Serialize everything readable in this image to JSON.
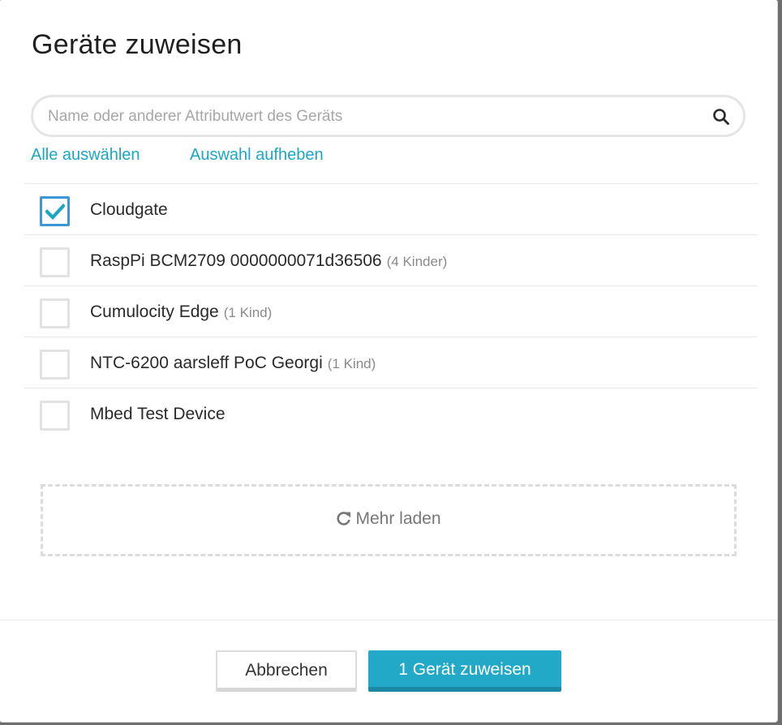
{
  "dialog": {
    "title": "Geräte zuweisen"
  },
  "search": {
    "placeholder": "Name oder anderer Attributwert des Geräts",
    "value": ""
  },
  "actions": {
    "select_all": "Alle auswählen",
    "clear_selection": "Auswahl aufheben"
  },
  "devices": [
    {
      "name": "Cloudgate",
      "children": "",
      "checked": true
    },
    {
      "name": "RaspPi BCM2709 0000000071d36506",
      "children": "(4 Kinder)",
      "checked": false
    },
    {
      "name": "Cumulocity Edge",
      "children": "(1 Kind)",
      "checked": false
    },
    {
      "name": "NTC-6200 aarsleff PoC Georgi",
      "children": "(1 Kind)",
      "checked": false
    },
    {
      "name": "Mbed Test Device",
      "children": "",
      "checked": false
    }
  ],
  "load_more": {
    "label": "Mehr laden",
    "icon": "refresh-icon"
  },
  "footer": {
    "cancel_label": "Abbrechen",
    "assign_label": "1 Gerät zuweisen"
  },
  "colors": {
    "accent": "#1ba6c4",
    "primary_button": "#23a9c8",
    "checkbox_checked_border": "#3b98d8"
  }
}
